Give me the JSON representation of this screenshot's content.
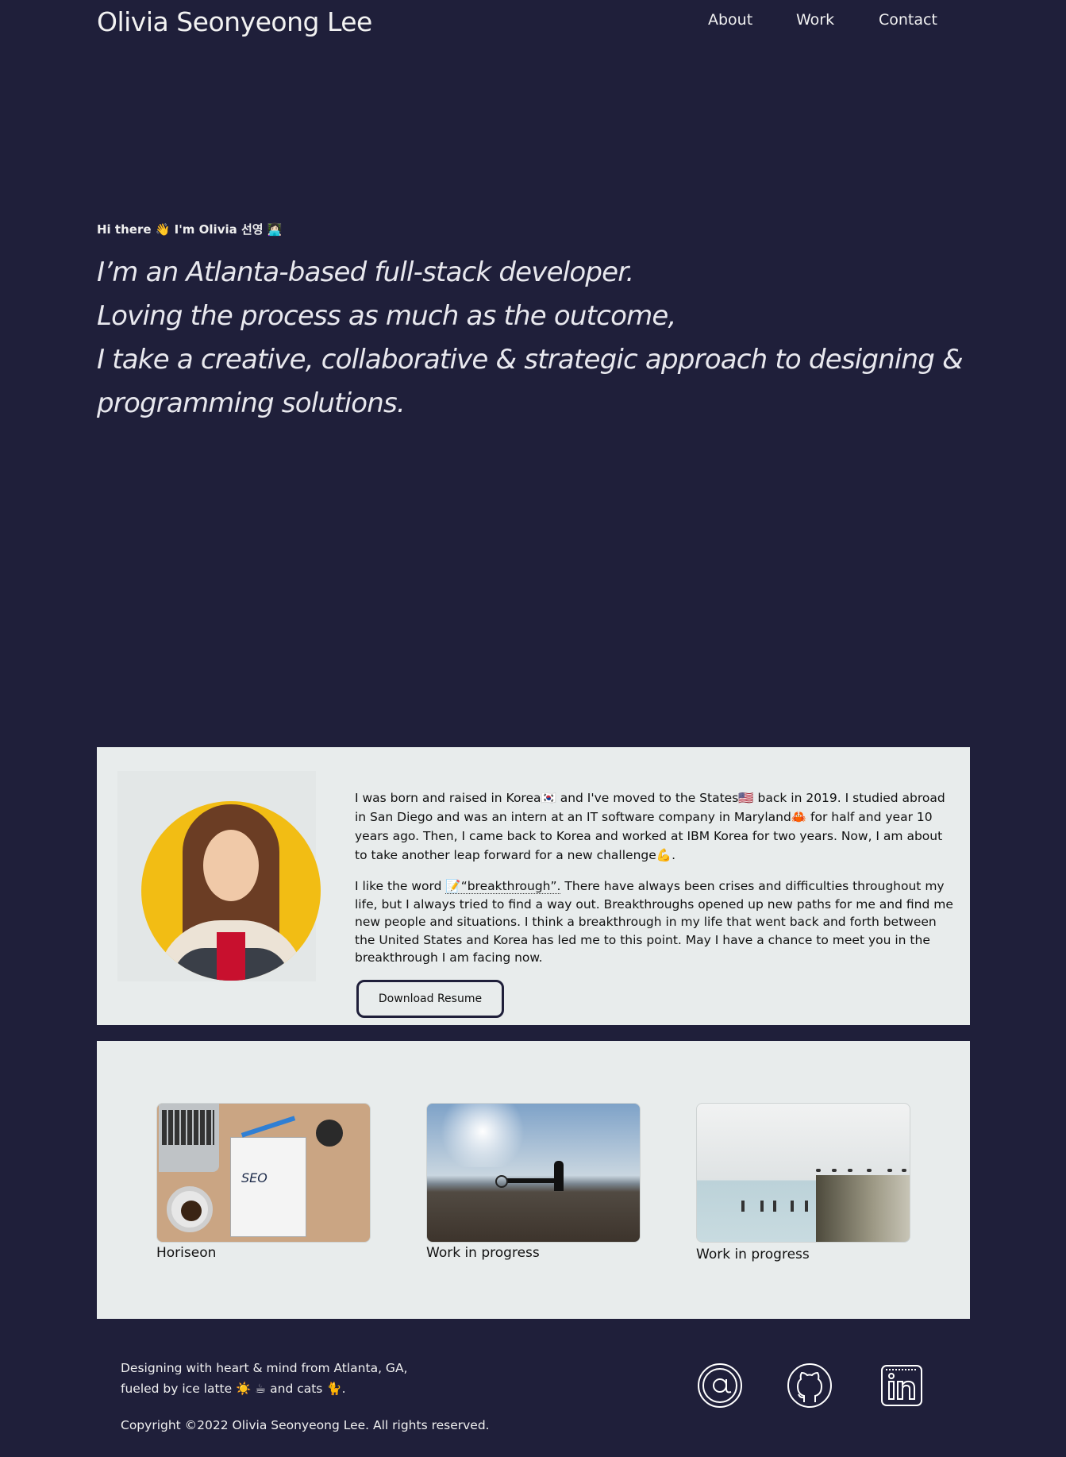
{
  "header": {
    "site_title": "Olivia Seonyeong Lee",
    "nav": [
      "About",
      "Work",
      "Contact"
    ]
  },
  "hero": {
    "greeting": "Hi there 👋 I'm Olivia 선영 👩🏻‍💻",
    "tagline_lines": [
      "I’m an Atlanta-based full-stack developer.",
      "Loving the process as much as the outcome,",
      "I take a creative, collaborative & strategic approach to designing &",
      "programming solutions."
    ]
  },
  "about": {
    "paragraph1": "I was born and raised in Korea🇰🇷 and I've moved to the States🇺🇸 back in 2019. I studied abroad in San Diego and was an intern at an IT software company in Maryland🦀 for half and year 10 years ago. Then, I came back to Korea and worked at IBM Korea for two years. Now, I am about to take another leap forward for a new challenge💪.",
    "paragraph2_before": "I like the word ",
    "paragraph2_word": "📝“breakthrough”.",
    "paragraph2_after": " There have always been crises and difficulties throughout my life, but I always tried to find a way out. Breakthroughs opened up new paths for me and find me new people and situations. I think a breakthrough in my life that went back and forth between the United States and Korea has led me to this point. May I have a chance to meet you in the breakthrough I am facing now.",
    "resume_button": "Download Resume"
  },
  "work": {
    "projects": [
      {
        "caption": "Horiseon",
        "thumb_text": "SEO"
      },
      {
        "caption": "Work in progress"
      },
      {
        "caption": "Work in progress"
      }
    ]
  },
  "footer": {
    "tagline_line1": "Designing with heart & mind from Atlanta, GA,",
    "tagline_line2": "fueled by ice latte ☀️ ☕ and cats 🐈.",
    "copyright": "Copyright ©2022 Olivia Seonyeong Lee. All rights reserved.",
    "social_icons": [
      "email-icon",
      "github-icon",
      "linkedin-icon"
    ]
  }
}
